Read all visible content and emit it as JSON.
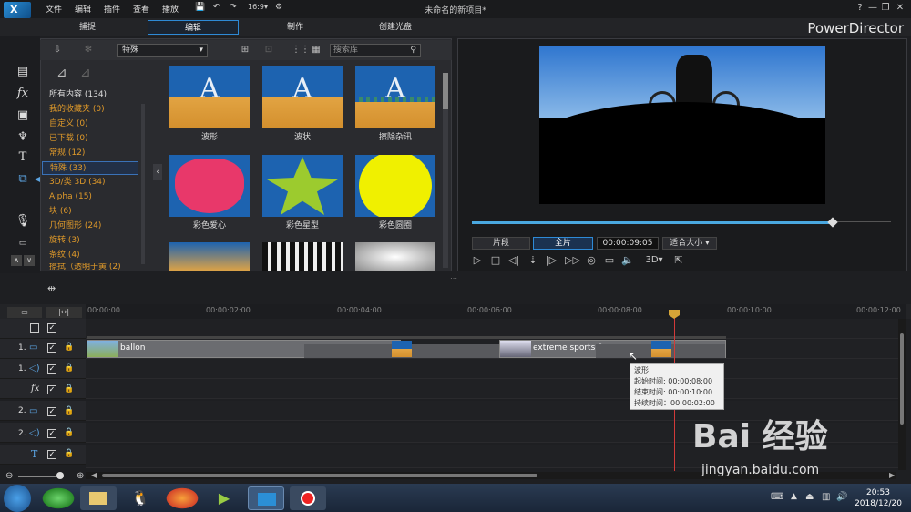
{
  "menu": {
    "file": "文件",
    "edit": "编辑",
    "plugin": "插件",
    "view": "查看",
    "play": "播放"
  },
  "window_title": "未命名的新项目*",
  "window_buttons": {
    "help": "?",
    "minimize": "—",
    "restore": "❐",
    "close": "✕"
  },
  "tabs": [
    {
      "label": "捕捉"
    },
    {
      "label": "编辑"
    },
    {
      "label": "制作"
    },
    {
      "label": "创建光盘"
    }
  ],
  "brand": "PowerDirector",
  "library": {
    "category_select": "特殊",
    "search_placeholder": "搜索库",
    "categories": [
      {
        "label": "所有内容 (134)"
      },
      {
        "label": "我的收藏夹 (0)"
      },
      {
        "label": "自定义 (0)"
      },
      {
        "label": "已下载 (0)"
      },
      {
        "label": "常规 (12)"
      },
      {
        "label": "特殊 (33)"
      },
      {
        "label": "3D/类 3D (34)"
      },
      {
        "label": "Alpha (15)"
      },
      {
        "label": "块 (6)"
      },
      {
        "label": "几何图形 (24)"
      },
      {
        "label": "旋转 (3)"
      },
      {
        "label": "条纹 (4)"
      },
      {
        "label": "擦拭（透明于黄 (2)"
      }
    ],
    "thumbnails": [
      {
        "label": "波形"
      },
      {
        "label": "波状"
      },
      {
        "label": "擦除杂讯"
      },
      {
        "label": "彩色爱心"
      },
      {
        "label": "彩色星型"
      },
      {
        "label": "彩色圆圈"
      }
    ]
  },
  "preview": {
    "clip_label": "片段",
    "full_label": "全片",
    "timecode": "00:00:09:05",
    "fit_label": "适合大小",
    "mode_3d": "3D",
    "progress": 0.86
  },
  "timeline": {
    "ticks": [
      "00:00:00",
      "00:00:02:00",
      "00:00:04:00",
      "00:00:06:00",
      "00:00:08:00",
      "00:00:10:00",
      "00:00:12:00"
    ],
    "tracks": [
      {
        "num": "1."
      },
      {
        "num": "1."
      },
      {
        "num": ""
      },
      {
        "num": "2."
      },
      {
        "num": "2."
      },
      {
        "num": ""
      }
    ],
    "clips": {
      "clip1": "ballon",
      "clip2": "extreme sports 0"
    },
    "tooltip": {
      "title": "波形",
      "start": "起始时间: 00:00:08:00",
      "end": "结束时间: 00:00:10:00",
      "duration": "持续时间：00:00:02:00"
    }
  },
  "taskbar": {
    "time": "20:53",
    "date": "2018/12/20"
  },
  "watermark": {
    "text": "Bai 经验",
    "url": "jingyan.baidu.com"
  }
}
